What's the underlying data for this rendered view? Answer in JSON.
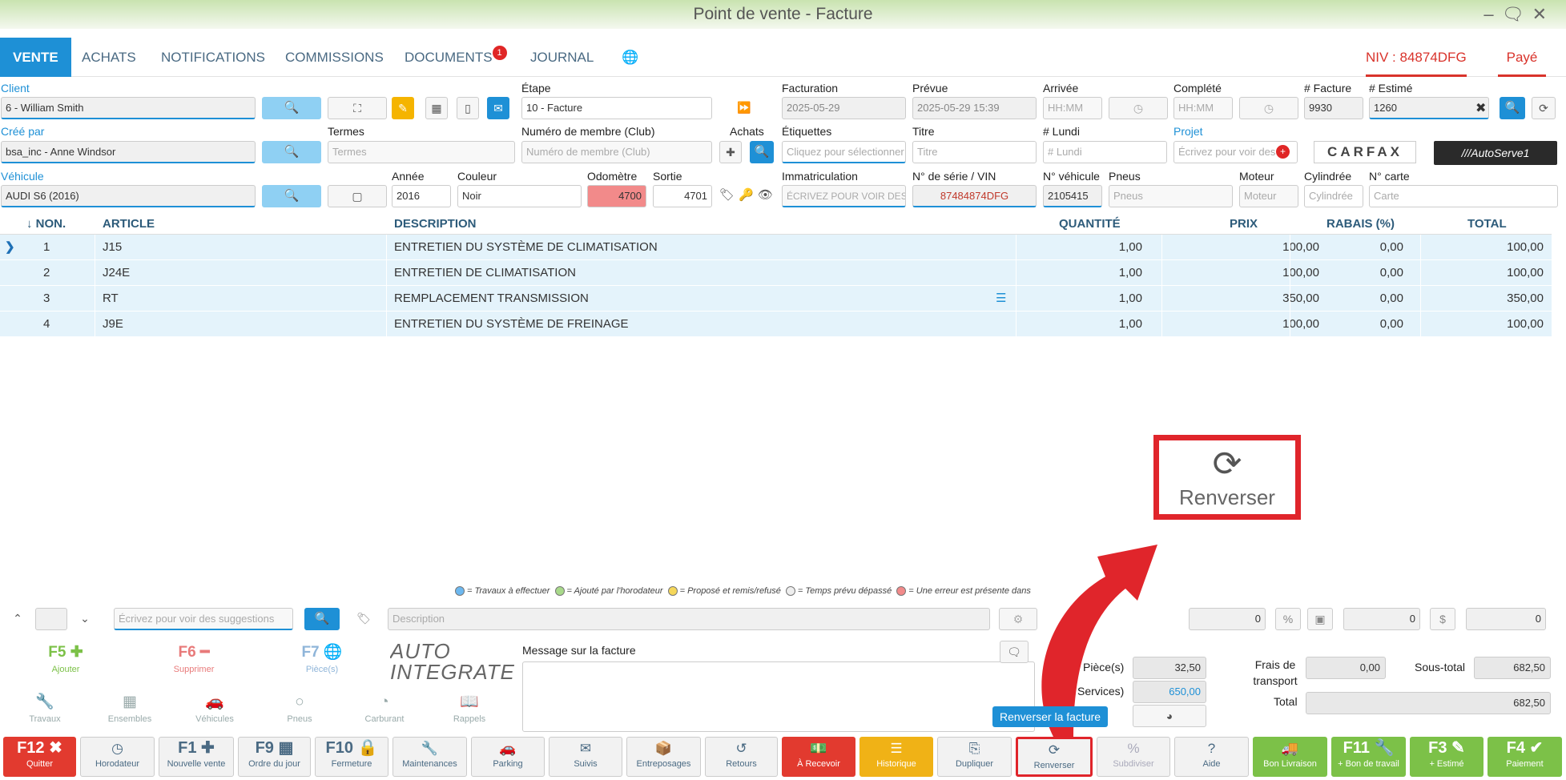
{
  "window": {
    "title": "Point de vente - Facture"
  },
  "tabs": [
    "VENTE",
    "ACHATS",
    "NOTIFICATIONS",
    "COMMISSIONS",
    "DOCUMENTS",
    "JOURNAL"
  ],
  "documents_badge": "1",
  "niv": "NIV : 84874DFG",
  "status": "Payé",
  "form": {
    "client_label": "Client",
    "client_value": "6 - William Smith",
    "etape_label": "Étape",
    "etape_value": "10 - Facture",
    "facturation_label": "Facturation",
    "facturation_value": "2025-05-29",
    "prevue_label": "Prévue",
    "prevue_value": "2025-05-29 15:39",
    "arrivee_label": "Arrivée",
    "arrivee_ph": "HH:MM",
    "complete_label": "Complété",
    "complete_ph": "HH:MM",
    "facture_label": "# Facture",
    "facture_value": "9930",
    "estime_label": "# Estimé",
    "estime_value": "1260",
    "cree_label": "Créé par",
    "cree_value": "bsa_inc - Anne Windsor",
    "termes_label": "Termes",
    "termes_ph": "Termes",
    "membre_label": "Numéro de membre (Club)",
    "membre_ph": "Numéro de membre (Club)",
    "achats_label": "Achats",
    "etiquettes_label": "Étiquettes",
    "etiquettes_ph": "Cliquez pour sélectionner",
    "titre_label": "Titre",
    "titre_ph": "Titre",
    "lundi_label": "# Lundi",
    "lundi_ph": "# Lundi",
    "projet_label": "Projet",
    "projet_ph": "Écrivez pour voir des",
    "vehicule_label": "Véhicule",
    "vehicule_value": "AUDI S6 (2016)",
    "annee_label": "Année",
    "annee_value": "2016",
    "couleur_label": "Couleur",
    "couleur_value": "Noir",
    "odometre_label": "Odomètre",
    "odometre_value": "4700",
    "sortie_label": "Sortie",
    "sortie_value": "4701",
    "immat_label": "Immatriculation",
    "immat_ph": "ÉCRIVEZ POUR VOIR DES",
    "vin_label": "N° de série / VIN",
    "vin_value": "87484874DFG",
    "nveh_label": "N° véhicule",
    "nveh_value": "2105415",
    "pneus_label": "Pneus",
    "pneus_ph": "Pneus",
    "moteur_label": "Moteur",
    "moteur_ph": "Moteur",
    "cyl_label": "Cylindrée",
    "cyl_ph": "Cylindrée",
    "carte_label": "N° carte",
    "carte_ph": "Carte",
    "carfax": "CARFAX",
    "autoserve": "///AutoServe1"
  },
  "table": {
    "headers": [
      "↓ NON.",
      "ARTICLE",
      "DESCRIPTION",
      "QUANTITÉ",
      "PRIX",
      "RABAIS (%)",
      "TOTAL"
    ],
    "rows": [
      {
        "no": "1",
        "article": "J15",
        "description": "ENTRETIEN DU SYSTÈME DE CLIMATISATION",
        "qty": "1,00",
        "prix": "100,00",
        "rabais": "0,00",
        "total": "100,00"
      },
      {
        "no": "2",
        "article": "J24E",
        "description": "ENTRETIEN DE CLIMATISATION",
        "qty": "1,00",
        "prix": "100,00",
        "rabais": "0,00",
        "total": "100,00"
      },
      {
        "no": "3",
        "article": "RT",
        "description": "REMPLACEMENT TRANSMISSION",
        "qty": "1,00",
        "prix": "350,00",
        "rabais": "0,00",
        "total": "350,00"
      },
      {
        "no": "4",
        "article": "J9E",
        "description": "ENTRETIEN DU SYSTÈME DE FREINAGE",
        "qty": "1,00",
        "prix": "100,00",
        "rabais": "0,00",
        "total": "100,00"
      }
    ]
  },
  "callout": {
    "label": "Renverser"
  },
  "legend": [
    "= Travaux à effectuer",
    "= Ajouté par l'horodateur",
    "= Proposé et remis/refusé",
    "= Temps prévu dépassé",
    "= Une erreur est présente dans"
  ],
  "entry": {
    "suggest_ph": "Écrivez pour voir des suggestions",
    "desc_ph": "Description",
    "val1": "0",
    "val2": "0",
    "val3": "0"
  },
  "actions": [
    {
      "k": "F5",
      "t": "Ajouter"
    },
    {
      "k": "F6",
      "t": "Supprimer"
    },
    {
      "k": "F7",
      "t": "Pièce(s)"
    }
  ],
  "categories": [
    "Travaux",
    "Ensembles",
    "Véhicules",
    "Pneus",
    "Carburant",
    "Rappels"
  ],
  "logo": "AUTO INTEGRATE",
  "message_label": "Message sur la facture",
  "totals": {
    "pieces_label": "Pièce(s)",
    "pieces": "32,50",
    "services_label": "Services)",
    "services": "650,00",
    "frais_label": "Frais de transport",
    "frais": "0,00",
    "sous_total_label": "Sous-total",
    "sous_total": "682,50",
    "total_label": "Total",
    "total": "682,50"
  },
  "tooltip": "Renverser la facture",
  "fkeys": [
    {
      "k": "F12",
      "t": "Quitter"
    },
    {
      "k": "",
      "t": "Horodateur"
    },
    {
      "k": "F1",
      "t": "Nouvelle vente"
    },
    {
      "k": "F9",
      "t": "Ordre du jour"
    },
    {
      "k": "F10",
      "t": "Fermeture"
    },
    {
      "k": "",
      "t": "Maintenances"
    },
    {
      "k": "",
      "t": "Parking"
    },
    {
      "k": "",
      "t": "Suivis"
    },
    {
      "k": "",
      "t": "Entreposages"
    },
    {
      "k": "",
      "t": "Retours"
    },
    {
      "k": "",
      "t": "À Recevoir"
    },
    {
      "k": "",
      "t": "Historique"
    },
    {
      "k": "",
      "t": "Dupliquer"
    },
    {
      "k": "",
      "t": "Renverser"
    },
    {
      "k": "",
      "t": "Subdiviser"
    },
    {
      "k": "",
      "t": "Aide"
    },
    {
      "k": "",
      "t": "Bon Livraison"
    },
    {
      "k": "F11",
      "t": "+ Bon de travail"
    },
    {
      "k": "F3",
      "t": "+ Estimé"
    },
    {
      "k": "F4",
      "t": "Paiement"
    }
  ],
  "colors": {
    "accent": "#1e90d6",
    "danger": "#e23a2f",
    "warning": "#f0b216",
    "success": "#7cc148"
  }
}
